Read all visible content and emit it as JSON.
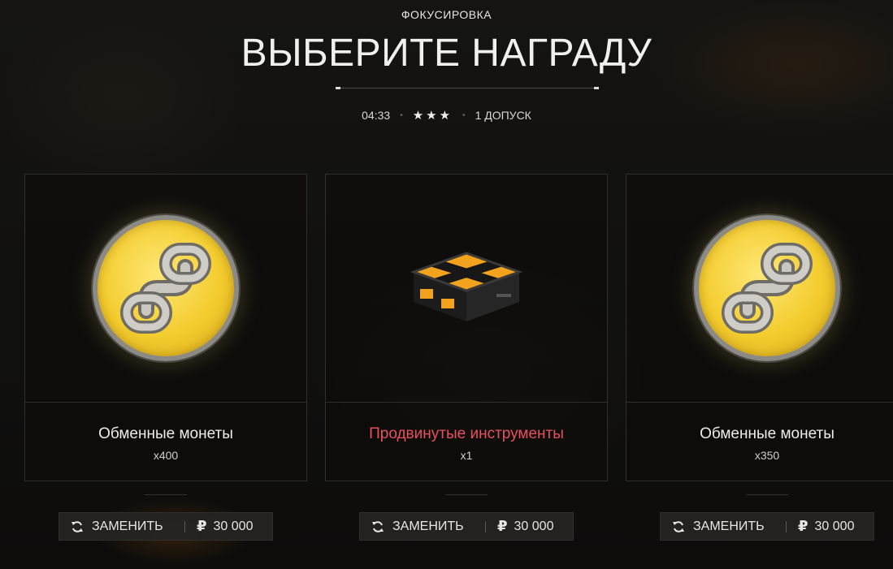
{
  "header": {
    "subtitle": "ФОКУСИРОВКА",
    "title": "ВЫБЕРИТЕ НАГРАДУ",
    "timer": "04:33",
    "stars": "★★★",
    "tickets": "1 ДОПУСК"
  },
  "rewards": [
    {
      "name": "Обменные монеты",
      "qty": "x400",
      "icon": "exchange-coin-icon",
      "replace_label": "ЗАМЕНИТЬ",
      "price": "30 000",
      "currency": "₽"
    },
    {
      "name": "Продвинутые инструменты",
      "qty": "x1",
      "icon": "advanced-tools-box-icon",
      "replace_label": "ЗАМЕНИТЬ",
      "price": "30 000",
      "currency": "₽",
      "highlight_color": "#e8505e"
    },
    {
      "name": "Обменные монеты",
      "qty": "x350",
      "icon": "exchange-coin-icon",
      "replace_label": "ЗАМЕНИТЬ",
      "price": "30 000",
      "currency": "₽"
    }
  ]
}
